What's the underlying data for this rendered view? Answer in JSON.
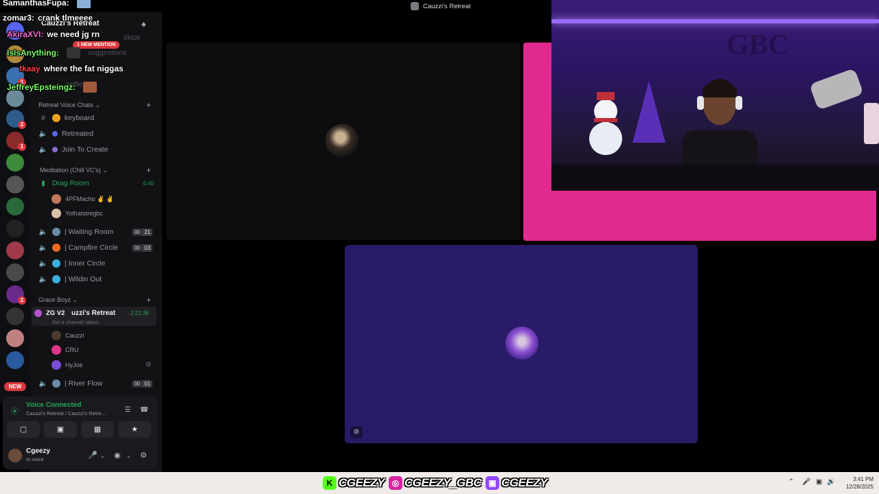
{
  "window": {
    "title": "Cauzzi's Retreat"
  },
  "server": {
    "name": "Cauzzi's Retreat",
    "new_mention_label": "1 NEW MENTION",
    "faded_channels": [
      "tiktok",
      "suggestions",
      "selfies"
    ]
  },
  "rail": {
    "new_label": "NEW",
    "badges": [
      "1",
      "2",
      "1",
      "2"
    ]
  },
  "categories": [
    {
      "name": "Retreat Voice Chats"
    },
    {
      "name": "Meditation (Chill VC's)"
    },
    {
      "name": "Grace Boyz"
    }
  ],
  "channels": {
    "keyboard": "keyboard",
    "retreated": "Retreated",
    "join_to_create": "Join To Create",
    "drag_room": "Drag Room",
    "drag_room_time": "0:40",
    "waiting_room": "| Waiting Room",
    "waiting_room_count": [
      "00",
      "21"
    ],
    "campfire_circle": "| Campfire Circle",
    "campfire_circle_count": [
      "00",
      "03"
    ],
    "inner_circle": "| Inner Circle",
    "wildin_out": "| Wildin Out",
    "river_flow": "| River Flow",
    "river_flow_count": [
      "00",
      "01"
    ]
  },
  "drag_room_users": [
    "4PFMacho ✌ ✌",
    "Yothatstregbc"
  ],
  "current_channel": {
    "tag": "ZG V2",
    "name": "uzzi's Retreat",
    "time": "2:21:38",
    "status": "Set a channel status",
    "users": [
      "Cauzzi",
      "CRU",
      "HyJoe"
    ]
  },
  "voice_panel": {
    "title": "Voice Connected",
    "subtitle": "Cauzzi's Retreat / Cauzzi's Retre...",
    "user_name": "Cgeezy",
    "user_status": "In voice"
  },
  "chat": [
    {
      "user": "SamanthasFupa:",
      "message": "",
      "color": "#ffffff"
    },
    {
      "user": "zomar3:",
      "message": "crank tlmeeee",
      "color": "#ffffff"
    },
    {
      "user": "AkiraXVI:",
      "message": "we need jg rn",
      "color": "#ff6ad5"
    },
    {
      "user": "IsIsAnything:",
      "message": "",
      "color": "#7cff6a"
    },
    {
      "user": "tkaay",
      "message": "where the fat niggas",
      "color": "#ff3b3b"
    },
    {
      "user": "JeffreyEpsteingz:",
      "message": "",
      "color": "#7cff6a"
    }
  ],
  "socials": [
    {
      "platform": "kick",
      "glyph": "K",
      "handle": "CGEEZY",
      "color": "#53fc18"
    },
    {
      "platform": "instagram",
      "glyph": "◎",
      "handle": "CGEEZY_GBC",
      "color": "#d6249f"
    },
    {
      "platform": "twitch",
      "glyph": "▣",
      "handle": "CGEEZY",
      "color": "#9146ff"
    }
  ],
  "clock": {
    "time": "3:41 PM",
    "date": "12/28/2025"
  },
  "colors": {
    "accent_green": "#23a55a",
    "cam_frame": "#e02a8f",
    "tile_purple": "#2a1b68",
    "danger": "#da373c"
  }
}
